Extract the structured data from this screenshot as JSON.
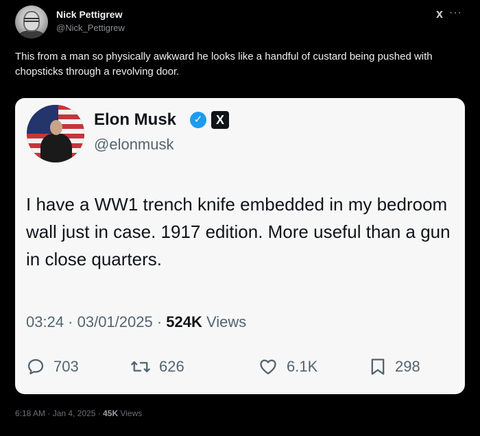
{
  "outer_tweet": {
    "author_name": "Nick Pettigrew",
    "author_handle": "@Nick_Pettigrew",
    "logo": "x",
    "more": "···",
    "text": "This from a man so physically awkward he looks like a handful of custard being pushed with chopsticks through a revolving door.",
    "footer": {
      "datetime": "6:18 AM · Jan 4, 2025 ·",
      "views_count": "45K",
      "views_label": "Views"
    }
  },
  "quoted_tweet": {
    "author_name": "Elon Musk",
    "author_handle": "@elonmusk",
    "verified_icon": "verified-check-icon",
    "badge_label": "X",
    "text": "I have a WW1 trench knife embedded in my bedroom wall just in case. 1917 edition. More useful than a gun in close quarters.",
    "meta": {
      "datetime": "03:24 · 03/01/2025 ·",
      "views_count": "524K",
      "views_label": "Views"
    },
    "actions": {
      "replies": "703",
      "reposts": "626",
      "likes": "6.1K",
      "bookmarks": "298"
    }
  },
  "colors": {
    "background": "#000000",
    "card": "#f7f7f7",
    "verified": "#1d9bf0",
    "muted_text": "#536471"
  }
}
